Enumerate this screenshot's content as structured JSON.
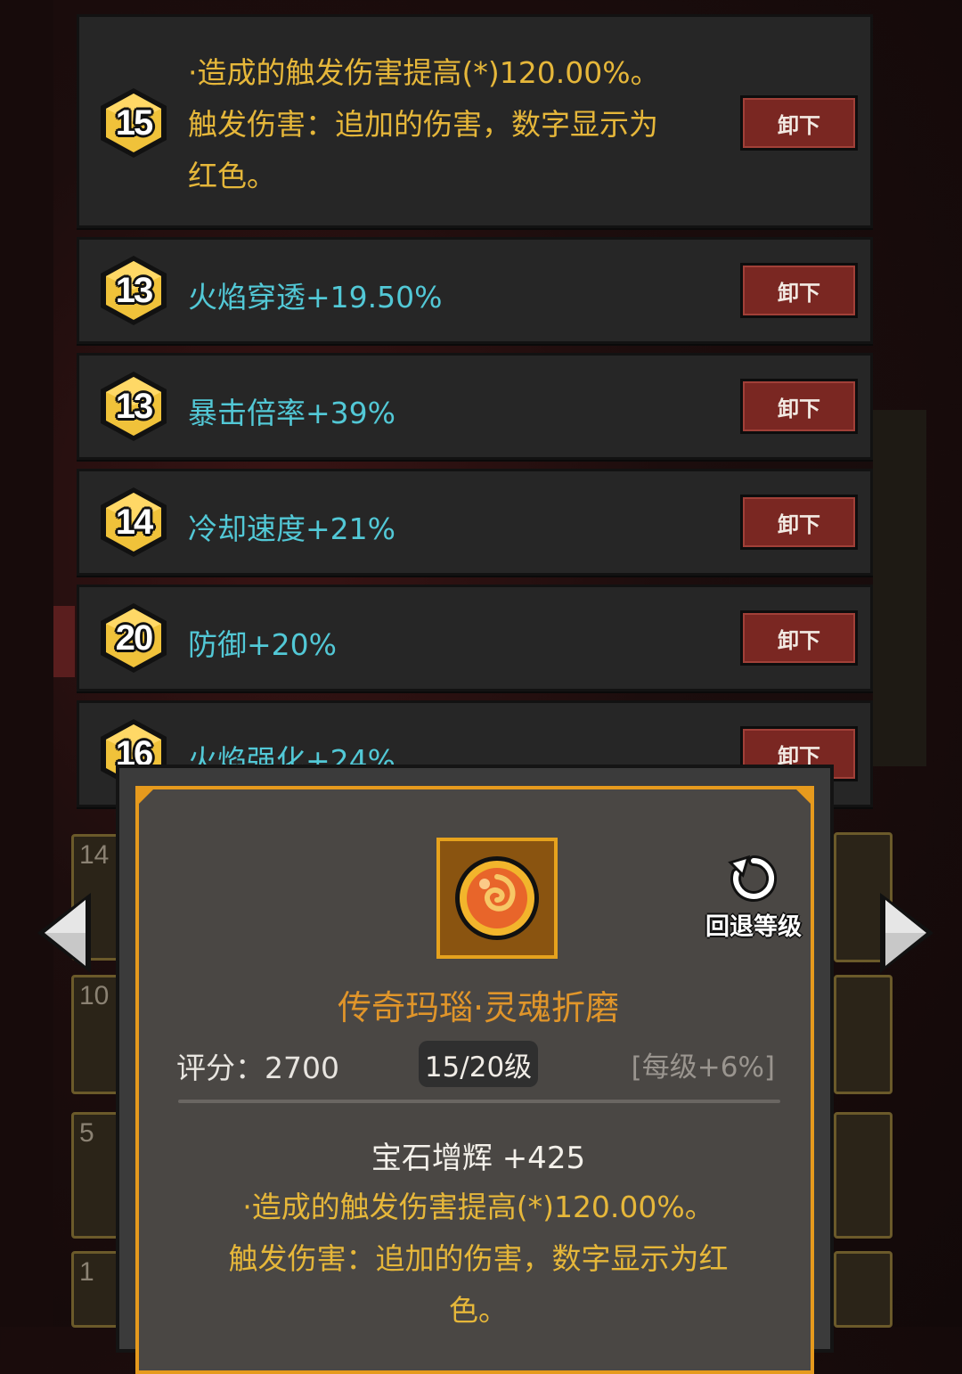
{
  "rows": [
    {
      "level": "15",
      "text_line1": "·造成的触发伤害提高(*)120.00%。",
      "text_line2": "触发伤害：追加的伤害，数字显示为",
      "text_line3": "红色。",
      "button": "卸下"
    },
    {
      "level": "13",
      "text": "火焰穿透+19.50%",
      "button": "卸下"
    },
    {
      "level": "13",
      "text": "暴击倍率+39%",
      "button": "卸下"
    },
    {
      "level": "14",
      "text": "冷却速度+21%",
      "button": "卸下"
    },
    {
      "level": "20",
      "text": "防御+20%",
      "button": "卸下"
    },
    {
      "level": "16",
      "text": "火焰强化+24%",
      "button": "卸下"
    }
  ],
  "side_cards_left": [
    "14",
    "10",
    "5",
    "1"
  ],
  "popup": {
    "revert_label": "回退等级",
    "gem_name": "传奇玛瑙·灵魂折磨",
    "score": "评分：2700",
    "level": "15/20级",
    "per_level": "[每级+6%]",
    "bonus": "宝石增辉 +425",
    "desc_line1": "·造成的触发伤害提高(*)120.00%。",
    "desc_line2": "触发伤害：追加的伤害，数字显示为红",
    "desc_line3": "色。"
  },
  "colors": {
    "accent_orange": "#e69a1d",
    "stat_cyan": "#52c8d6",
    "effect_gold": "#e6b73a",
    "button_red": "#7a2722"
  },
  "icons": [
    "hexagon-level-badge",
    "revert-arrow-icon",
    "fire-agate-gem-icon",
    "left-arrow-icon",
    "right-arrow-icon"
  ]
}
